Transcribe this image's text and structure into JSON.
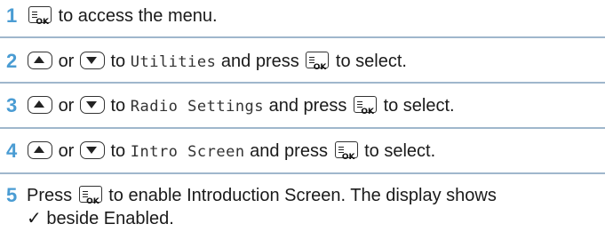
{
  "steps": [
    {
      "number": "1",
      "text": "to access the menu."
    },
    {
      "number": "2",
      "or": "or",
      "to": "to",
      "menu_item": "Utilities",
      "and_press": "and press",
      "after": "to select."
    },
    {
      "number": "3",
      "or": "or",
      "to": "to",
      "menu_item": "Radio Settings",
      "and_press": "and press",
      "after": "to select."
    },
    {
      "number": "4",
      "or": "or",
      "to": "to",
      "menu_item": "Intro Screen",
      "and_press": "and press",
      "after": "to select."
    },
    {
      "number": "5",
      "press": "Press",
      "text_line1": "to enable Introduction Screen. The display shows",
      "text_line2": "✓ beside Enabled."
    }
  ],
  "keys": {
    "ok_label": "OK"
  },
  "icons": {
    "menu_ok": "menu-ok-key-icon",
    "up": "up-arrow-key-icon",
    "down": "down-arrow-key-icon"
  },
  "colors": {
    "step_number": "#4a9cd3",
    "separator": "#9fb7cc",
    "text": "#1a1a1a"
  }
}
